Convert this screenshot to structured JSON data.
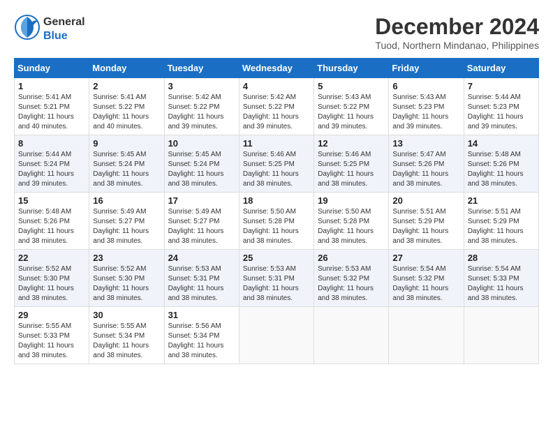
{
  "header": {
    "logo_line1": "General",
    "logo_line2": "Blue",
    "month_title": "December 2024",
    "location": "Tuod, Northern Mindanao, Philippines"
  },
  "weekdays": [
    "Sunday",
    "Monday",
    "Tuesday",
    "Wednesday",
    "Thursday",
    "Friday",
    "Saturday"
  ],
  "weeks": [
    [
      {
        "day": "1",
        "sunrise": "5:41 AM",
        "sunset": "5:21 PM",
        "daylight": "11 hours and 40 minutes."
      },
      {
        "day": "2",
        "sunrise": "5:41 AM",
        "sunset": "5:22 PM",
        "daylight": "11 hours and 40 minutes."
      },
      {
        "day": "3",
        "sunrise": "5:42 AM",
        "sunset": "5:22 PM",
        "daylight": "11 hours and 39 minutes."
      },
      {
        "day": "4",
        "sunrise": "5:42 AM",
        "sunset": "5:22 PM",
        "daylight": "11 hours and 39 minutes."
      },
      {
        "day": "5",
        "sunrise": "5:43 AM",
        "sunset": "5:22 PM",
        "daylight": "11 hours and 39 minutes."
      },
      {
        "day": "6",
        "sunrise": "5:43 AM",
        "sunset": "5:23 PM",
        "daylight": "11 hours and 39 minutes."
      },
      {
        "day": "7",
        "sunrise": "5:44 AM",
        "sunset": "5:23 PM",
        "daylight": "11 hours and 39 minutes."
      }
    ],
    [
      {
        "day": "8",
        "sunrise": "5:44 AM",
        "sunset": "5:24 PM",
        "daylight": "11 hours and 39 minutes."
      },
      {
        "day": "9",
        "sunrise": "5:45 AM",
        "sunset": "5:24 PM",
        "daylight": "11 hours and 38 minutes."
      },
      {
        "day": "10",
        "sunrise": "5:45 AM",
        "sunset": "5:24 PM",
        "daylight": "11 hours and 38 minutes."
      },
      {
        "day": "11",
        "sunrise": "5:46 AM",
        "sunset": "5:25 PM",
        "daylight": "11 hours and 38 minutes."
      },
      {
        "day": "12",
        "sunrise": "5:46 AM",
        "sunset": "5:25 PM",
        "daylight": "11 hours and 38 minutes."
      },
      {
        "day": "13",
        "sunrise": "5:47 AM",
        "sunset": "5:26 PM",
        "daylight": "11 hours and 38 minutes."
      },
      {
        "day": "14",
        "sunrise": "5:48 AM",
        "sunset": "5:26 PM",
        "daylight": "11 hours and 38 minutes."
      }
    ],
    [
      {
        "day": "15",
        "sunrise": "5:48 AM",
        "sunset": "5:26 PM",
        "daylight": "11 hours and 38 minutes."
      },
      {
        "day": "16",
        "sunrise": "5:49 AM",
        "sunset": "5:27 PM",
        "daylight": "11 hours and 38 minutes."
      },
      {
        "day": "17",
        "sunrise": "5:49 AM",
        "sunset": "5:27 PM",
        "daylight": "11 hours and 38 minutes."
      },
      {
        "day": "18",
        "sunrise": "5:50 AM",
        "sunset": "5:28 PM",
        "daylight": "11 hours and 38 minutes."
      },
      {
        "day": "19",
        "sunrise": "5:50 AM",
        "sunset": "5:28 PM",
        "daylight": "11 hours and 38 minutes."
      },
      {
        "day": "20",
        "sunrise": "5:51 AM",
        "sunset": "5:29 PM",
        "daylight": "11 hours and 38 minutes."
      },
      {
        "day": "21",
        "sunrise": "5:51 AM",
        "sunset": "5:29 PM",
        "daylight": "11 hours and 38 minutes."
      }
    ],
    [
      {
        "day": "22",
        "sunrise": "5:52 AM",
        "sunset": "5:30 PM",
        "daylight": "11 hours and 38 minutes."
      },
      {
        "day": "23",
        "sunrise": "5:52 AM",
        "sunset": "5:30 PM",
        "daylight": "11 hours and 38 minutes."
      },
      {
        "day": "24",
        "sunrise": "5:53 AM",
        "sunset": "5:31 PM",
        "daylight": "11 hours and 38 minutes."
      },
      {
        "day": "25",
        "sunrise": "5:53 AM",
        "sunset": "5:31 PM",
        "daylight": "11 hours and 38 minutes."
      },
      {
        "day": "26",
        "sunrise": "5:53 AM",
        "sunset": "5:32 PM",
        "daylight": "11 hours and 38 minutes."
      },
      {
        "day": "27",
        "sunrise": "5:54 AM",
        "sunset": "5:32 PM",
        "daylight": "11 hours and 38 minutes."
      },
      {
        "day": "28",
        "sunrise": "5:54 AM",
        "sunset": "5:33 PM",
        "daylight": "11 hours and 38 minutes."
      }
    ],
    [
      {
        "day": "29",
        "sunrise": "5:55 AM",
        "sunset": "5:33 PM",
        "daylight": "11 hours and 38 minutes."
      },
      {
        "day": "30",
        "sunrise": "5:55 AM",
        "sunset": "5:34 PM",
        "daylight": "11 hours and 38 minutes."
      },
      {
        "day": "31",
        "sunrise": "5:56 AM",
        "sunset": "5:34 PM",
        "daylight": "11 hours and 38 minutes."
      },
      null,
      null,
      null,
      null
    ]
  ],
  "labels": {
    "sunrise": "Sunrise:",
    "sunset": "Sunset:",
    "daylight": "Daylight:"
  }
}
